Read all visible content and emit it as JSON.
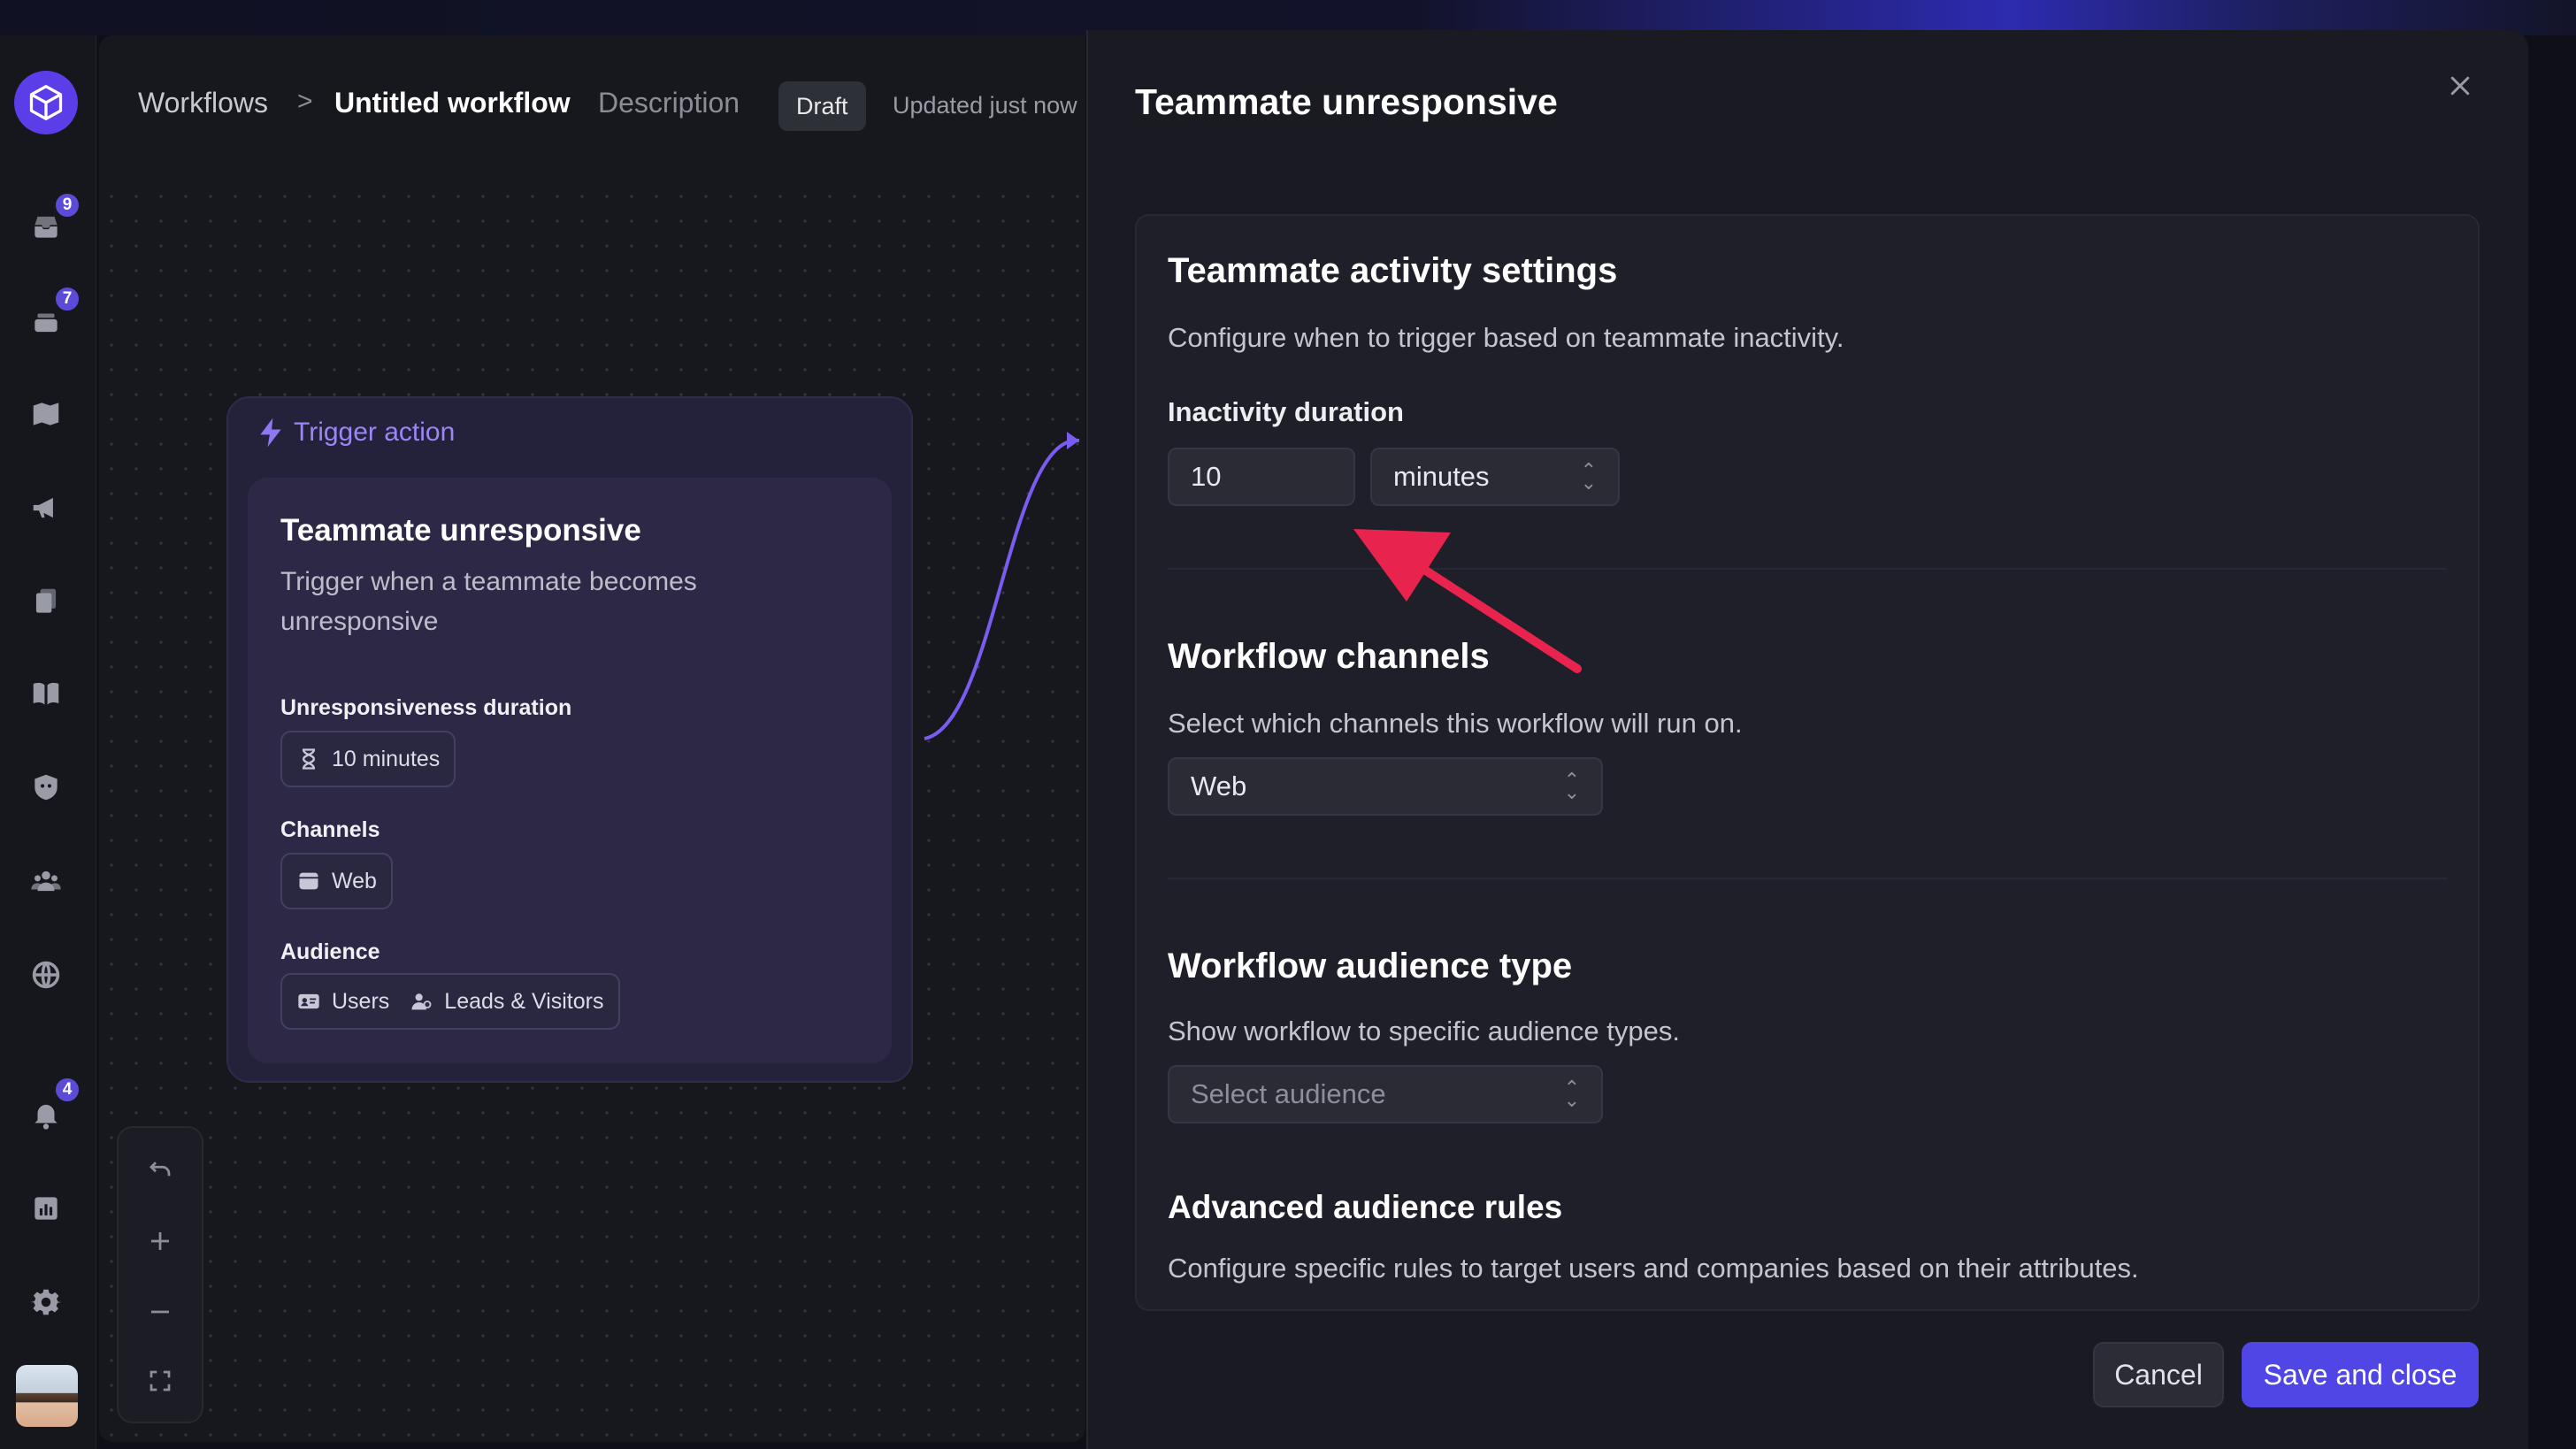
{
  "sidebar": {
    "badges": {
      "inbox": "9",
      "tickets": "7",
      "notifications": "4"
    }
  },
  "header": {
    "breadcrumb_root": "Workflows",
    "breadcrumb_separator": ">",
    "workflow_name": "Untitled workflow",
    "description_link": "Description",
    "status_badge": "Draft",
    "updated_text": "Updated just now"
  },
  "trigger_card": {
    "header_label": "Trigger action",
    "title": "Teammate unresponsive",
    "description": "Trigger when a teammate becomes unresponsive",
    "duration_label": "Unresponsiveness duration",
    "duration_value": "10 minutes",
    "channels_label": "Channels",
    "channels_value": "Web",
    "audience_label": "Audience",
    "audience_users": "Users",
    "audience_leads": "Leads & Visitors"
  },
  "panel": {
    "title": "Teammate unresponsive",
    "activity": {
      "title": "Teammate activity settings",
      "description": "Configure when to trigger based on teammate inactivity.",
      "field_label": "Inactivity duration",
      "duration_value": "10",
      "unit_value": "minutes"
    },
    "channels": {
      "title": "Workflow channels",
      "description": "Select which channels this workflow will run on.",
      "selected": "Web"
    },
    "audience": {
      "title": "Workflow audience type",
      "description": "Show workflow to specific audience types.",
      "placeholder": "Select audience"
    },
    "advanced": {
      "title": "Advanced audience rules",
      "description": "Configure specific rules to target users and companies based on their attributes."
    },
    "cancel_label": "Cancel",
    "save_label": "Save and close"
  },
  "colors": {
    "accent": "#4f46e5",
    "trigger_purple": "#9b86f5",
    "annotation_arrow": "#e8244e",
    "panel_bg": "#1a1b22"
  }
}
